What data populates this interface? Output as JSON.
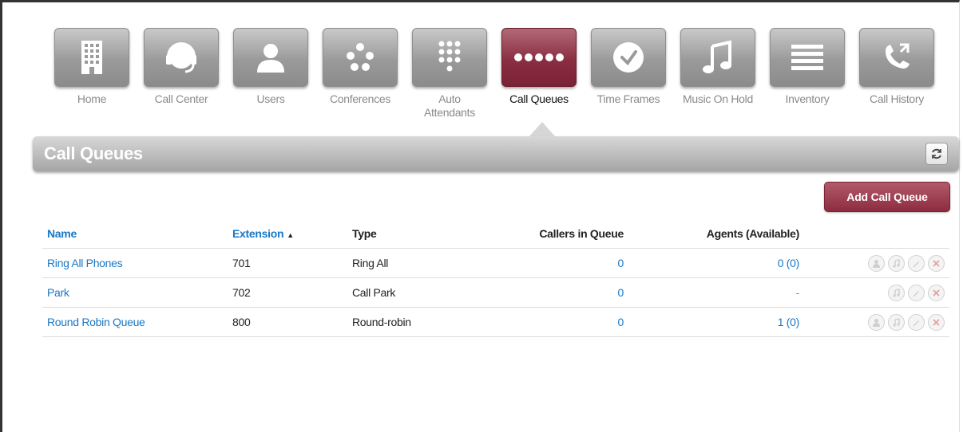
{
  "nav": {
    "tiles": [
      {
        "label": "Home",
        "icon": "building-icon"
      },
      {
        "label": "Call Center",
        "icon": "headset-icon"
      },
      {
        "label": "Users",
        "icon": "user-icon"
      },
      {
        "label": "Conferences",
        "icon": "conference-dots-icon"
      },
      {
        "label": "Auto Attendants",
        "icon": "keypad-icon"
      },
      {
        "label": "Call Queues",
        "icon": "queue-dots-icon",
        "active": true
      },
      {
        "label": "Time Frames",
        "icon": "clock-icon"
      },
      {
        "label": "Music On Hold",
        "icon": "music-note-icon"
      },
      {
        "label": "Inventory",
        "icon": "list-lines-icon"
      },
      {
        "label": "Call History",
        "icon": "phone-history-icon"
      }
    ]
  },
  "header": {
    "title": "Call Queues"
  },
  "actions": {
    "add_label": "Add Call Queue"
  },
  "table": {
    "columns": {
      "name": "Name",
      "extension": "Extension",
      "type": "Type",
      "callers": "Callers in Queue",
      "agents": "Agents (Available)"
    },
    "rows": [
      {
        "name": "Ring All Phones",
        "extension": "701",
        "type": "Ring All",
        "callers": "0",
        "agents": "0 (0)",
        "agents_link": true
      },
      {
        "name": "Park",
        "extension": "702",
        "type": "Call Park",
        "callers": "0",
        "agents": "-",
        "agents_link": false
      },
      {
        "name": "Round Robin Queue",
        "extension": "800",
        "type": "Round-robin",
        "callers": "0",
        "agents": "1 (0)",
        "agents_link": true
      }
    ]
  },
  "colors": {
    "accent": "#8e2c40",
    "link": "#1a77c4",
    "tile_gray": "#9a9a9a"
  }
}
